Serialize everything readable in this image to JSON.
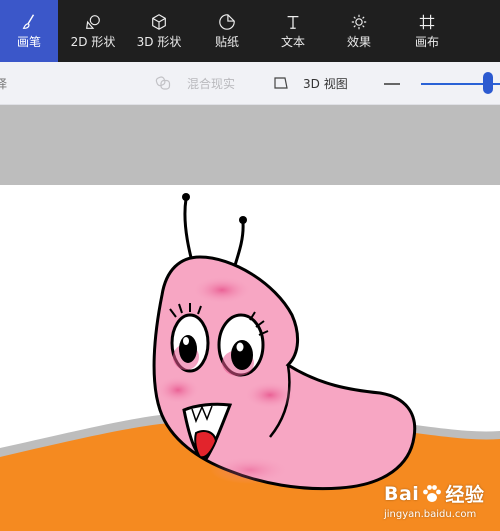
{
  "ribbon": {
    "tabs": [
      {
        "label": "画笔",
        "icon": "brush-icon",
        "active": true
      },
      {
        "label": "2D 形状",
        "icon": "shapes-2d-icon",
        "active": false
      },
      {
        "label": "3D 形状",
        "icon": "cube-icon",
        "active": false
      },
      {
        "label": "贴纸",
        "icon": "sticker-icon",
        "active": false
      },
      {
        "label": "文本",
        "icon": "text-icon",
        "active": false
      },
      {
        "label": "效果",
        "icon": "sun-icon",
        "active": false
      },
      {
        "label": "画布",
        "icon": "canvas-icon",
        "active": false
      }
    ],
    "active_color": "#3b57c9"
  },
  "commandbar": {
    "cut_label": "择",
    "mixed_reality_label": "混合现实",
    "view_3d_label": "3D 视图",
    "zoom_level": 0.85
  },
  "watermark": {
    "brand": "Bai",
    "brand_suffix": "经验",
    "url": "jingyan.baidu.com"
  }
}
